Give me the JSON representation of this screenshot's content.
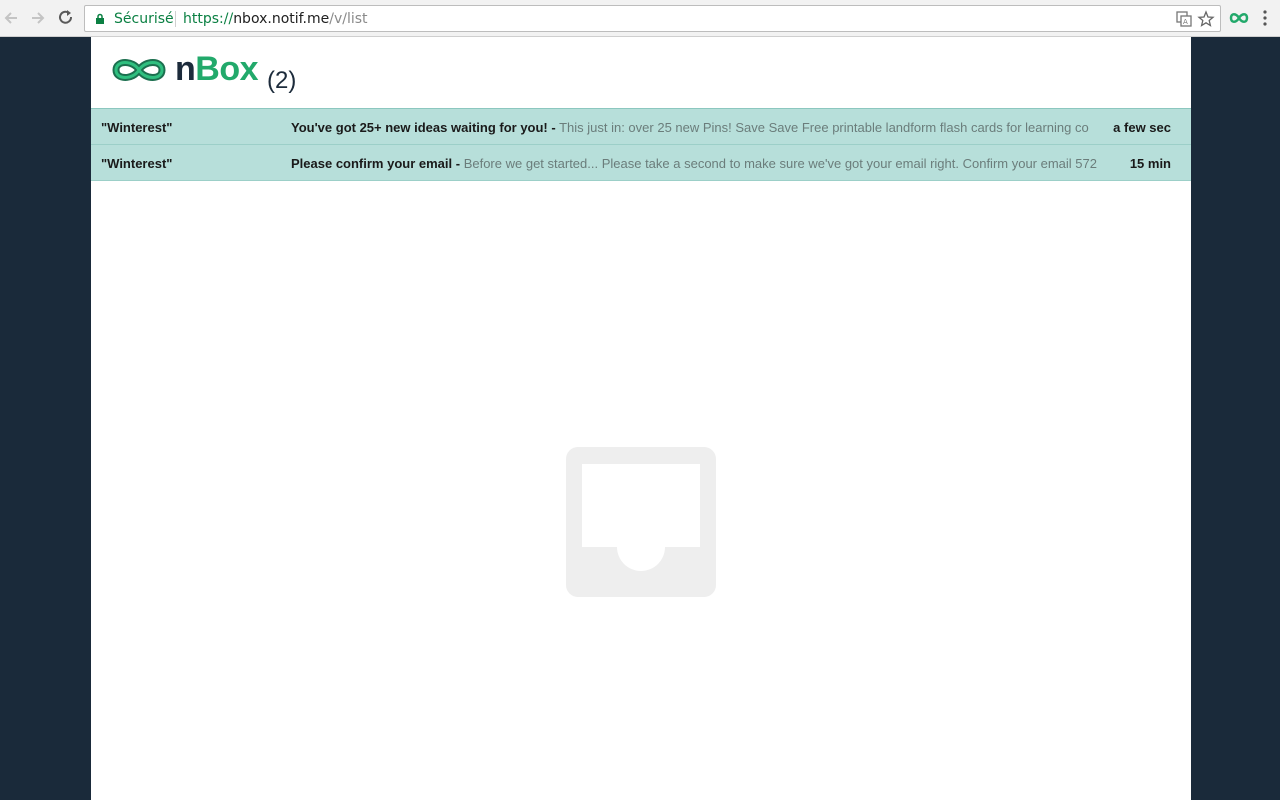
{
  "browser": {
    "secure_label": "Sécurisé",
    "url": {
      "scheme": "https://",
      "host": "nbox.notif.me",
      "path": "/v/list"
    },
    "accent_color": "#0b8043"
  },
  "header": {
    "brand_n": "n",
    "brand_box": "Box",
    "count": "(2)",
    "brand_color": "#22a96b"
  },
  "emails": [
    {
      "sender": "\"Winterest\"",
      "subject": "You've got 25+ new ideas waiting for you! -",
      "snippet": " This just in: over 25 new Pins! Save Save Free printable landform flash cards for learning co",
      "time": "a few sec"
    },
    {
      "sender": "\"Winterest\"",
      "subject": "Please confirm your email -",
      "snippet": " Before we get started... Please take a second to make sure we've got your email right. Confirm your email 572",
      "time": "15 min"
    }
  ],
  "row_color": "#b7dfda"
}
